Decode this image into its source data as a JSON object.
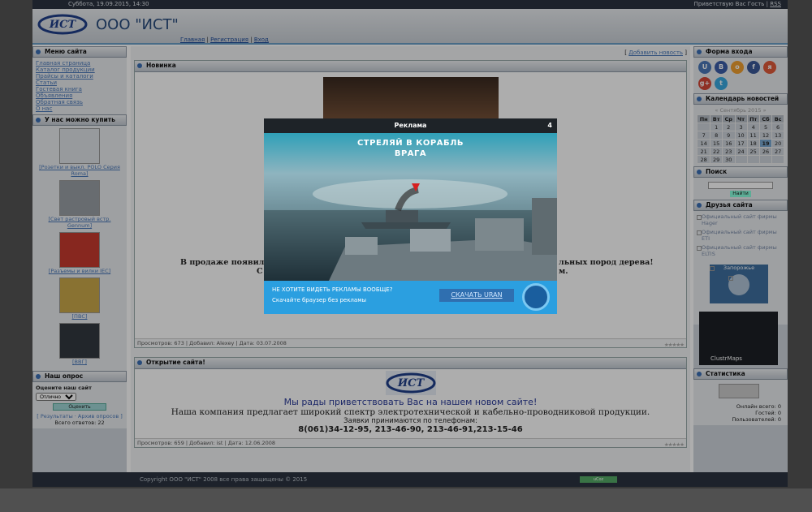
{
  "topbar": {
    "date": "Суббота, 19.09.2015, 14:30",
    "greeting": "Приветствую Вас Гость",
    "rss": "RSS"
  },
  "header": {
    "title": "ООО \"ИСТ\"",
    "logo_text": "ИСТ",
    "nav": [
      "Главная",
      "Регистрация",
      "Вход"
    ]
  },
  "left": {
    "menu_title": "Меню сайта",
    "menu": [
      "Главная страница",
      "Каталог продукции",
      "Прайсы и каталоги",
      "Статьи",
      "Гостевая книга",
      "Объявления",
      "Обратная связь",
      "О нас"
    ],
    "shop_title": "У нас можно купить",
    "shop": [
      {
        "label": "[Розетки и выкл. POLO Серия Roma]",
        "color": "#dfe3e8"
      },
      {
        "label": "[Свет растровый встр. Gennum]",
        "color": "#9aa0a6"
      },
      {
        "label": "[Разъемы и вилки IEC]",
        "color": "#c83a2e"
      },
      {
        "label": "[ПВС]",
        "color": "#caa94a"
      },
      {
        "label": "[ВВГ]",
        "color": "#333840"
      }
    ],
    "poll_title": "Наш опрос",
    "poll_q": "Оцените наш сайт",
    "poll_opt": "Отлично",
    "poll_btn": "Оценить",
    "poll_links": "[ Результаты · Архив опросов ]",
    "poll_total": "Всего ответов: 22"
  },
  "main": {
    "add": "Добавить новость",
    "post1": {
      "title": "Новинка",
      "text1": "В продаже появилас",
      "text1b": "льных пород дерева!",
      "text2": "С",
      "text2b": "м.",
      "meta": "Просмотров: 673 | Добавил: Alexey | Дата: 03.07.2008",
      "author": "Alexey"
    },
    "post2": {
      "title": "Открытие сайта!",
      "l1": "Мы рады приветствовать Вас на нашем новом сайте!",
      "l2": "Наша компания предлагает широкий спектр электротехнической и кабельно-проводниковой продукции.",
      "l3": "Заявки принимаются по телефонам:",
      "l4": "8(061)34-12-95, 213-46-90, 213-46-91,213-15-46",
      "meta": "Просмотров: 659 | Добавил: ist | Дата: 12.06.2008"
    }
  },
  "right": {
    "login_title": "Форма входа",
    "login_icons": [
      {
        "t": "U",
        "c": "#4a78b8"
      },
      {
        "t": "B",
        "c": "#3b5ea8"
      },
      {
        "t": "o",
        "c": "#f0a030"
      },
      {
        "t": "f",
        "c": "#3b5998"
      },
      {
        "t": "я",
        "c": "#e05a3a"
      },
      {
        "t": "g+",
        "c": "#d34836"
      },
      {
        "t": "t",
        "c": "#39a9e0"
      }
    ],
    "cal_title": "Календарь новостей",
    "cal_month": "« Сентябрь 2015 »",
    "cal_head": [
      "Пн",
      "Вт",
      "Ср",
      "Чт",
      "Пт",
      "Сб",
      "Вс"
    ],
    "cal_rows": [
      [
        "",
        "1",
        "2",
        "3",
        "4",
        "5",
        "6"
      ],
      [
        "7",
        "8",
        "9",
        "10",
        "11",
        "12",
        "13"
      ],
      [
        "14",
        "15",
        "16",
        "17",
        "18",
        "19",
        "20"
      ],
      [
        "21",
        "22",
        "23",
        "24",
        "25",
        "26",
        "27"
      ],
      [
        "28",
        "29",
        "30",
        "",
        "",
        "",
        ""
      ]
    ],
    "search_title": "Поиск",
    "search_btn": "Найти",
    "friends_title": "Друзья сайта",
    "friends": [
      "Официальный сайт фирмы Hager",
      "Официальный сайт фирмы ETI",
      "Официальный сайт фирмы ELTIS"
    ],
    "weather": "Запорожье",
    "clustr": "ClustrMaps",
    "stats_title": "Статистика",
    "stats": [
      "Онлайн всего: 0",
      "Гостей: 0",
      "Пользователей: 0"
    ]
  },
  "footer": {
    "copy": "Copyright ООО \"ИСТ\" 2008 все права защищены © 2015",
    "badge": "uCoz"
  },
  "ad": {
    "title": "Реклама",
    "count": "4",
    "headline1": "СТРЕЛЯЙ В КОРАБЛЬ",
    "headline2": "ВРАГА",
    "question": "НЕ ХОТИТЕ ВИДЕТЬ РЕКЛАМЫ ВООБЩЕ?",
    "sub": "Скачайте браузер без рекламы",
    "button": "СКАЧАТЬ URAN"
  }
}
